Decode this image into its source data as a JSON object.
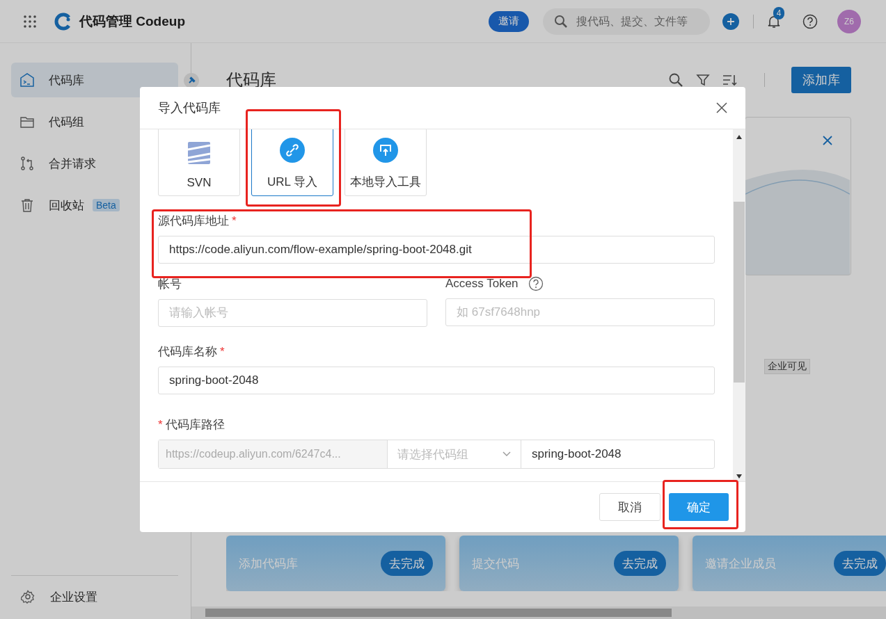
{
  "topbar": {
    "app_title": "代码管理 Codeup",
    "invite": "邀请",
    "search": {
      "placeholder": "搜代码、提交、文件等"
    },
    "notifications": "4",
    "avatar": "Z6"
  },
  "sidebar": {
    "items": [
      {
        "label": "代码库",
        "kind": "repo",
        "selected": true
      },
      {
        "label": "代码组",
        "kind": "folder",
        "selected": false
      },
      {
        "label": "合并请求",
        "kind": "merge",
        "selected": false
      },
      {
        "label": "回收站",
        "kind": "trash",
        "selected": false,
        "badge": "Beta"
      }
    ],
    "footer_item": "企业设置"
  },
  "page": {
    "title": "代码库",
    "add_button": "添加库",
    "visibility_tag": "企业可见",
    "tasks": [
      {
        "label": "添加代码库",
        "action": "去完成"
      },
      {
        "label": "提交代码",
        "action": "去完成"
      },
      {
        "label": "邀请企业成员",
        "action": "去完成"
      }
    ]
  },
  "dialog": {
    "title": "导入代码库",
    "sources": [
      {
        "label": "SVN",
        "kind": "svn",
        "selected": false
      },
      {
        "label": "URL 导入",
        "kind": "url",
        "selected": true
      },
      {
        "label": "本地导入工具",
        "kind": "local",
        "selected": false
      }
    ],
    "source_url": {
      "label": "源代码库地址",
      "required_mark": "*",
      "value": "https://code.aliyun.com/flow-example/spring-boot-2048.git"
    },
    "account": {
      "label": "帐号",
      "placeholder": "请输入帐号"
    },
    "token": {
      "label": "Access Token",
      "placeholder": "如 67sf7648hnp"
    },
    "repo_name": {
      "label": "代码库名称",
      "required_mark": "*",
      "value": "spring-boot-2048"
    },
    "repo_path": {
      "label": "代码库路径",
      "required_mark": "*",
      "prefix": "https://codeup.aliyun.com/6247c4...",
      "group_placeholder": "请选择代码组",
      "value": "spring-boot-2048"
    },
    "cancel": "取消",
    "confirm": "确定"
  }
}
